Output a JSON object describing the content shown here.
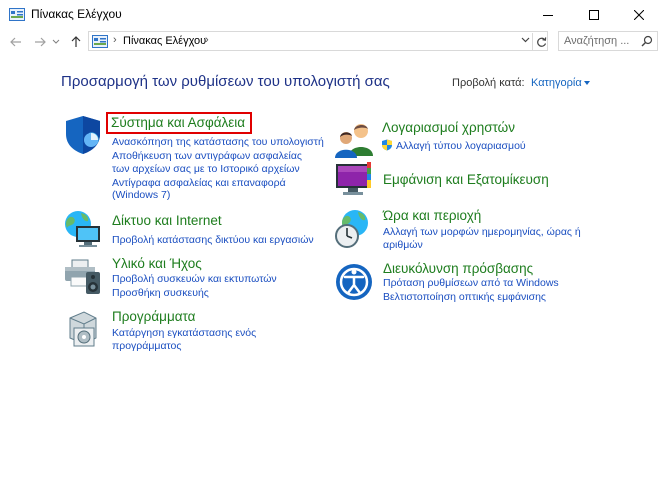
{
  "window": {
    "title": "Πίνακας Ελέγχου"
  },
  "address": {
    "path": "Πίνακας Ελέγχου",
    "search_placeholder": "Αναζήτηση ..."
  },
  "header": {
    "heading": "Προσαρμογή των ρυθμίσεων του υπολογιστή σας",
    "view_by_label": "Προβολή κατά:",
    "view_by_value": "Κατηγορία"
  },
  "categories_left": [
    {
      "title": "Σύστημα και Ασφάλεια",
      "links": [
        "Ανασκόπηση της κατάστασης του υπολογιστή",
        "Αποθήκευση των αντιγράφων ασφαλείας",
        "των αρχείων σας με το Ιστορικό αρχείων",
        "Αντίγραφα ασφαλείας και επαναφορά",
        "(Windows 7)"
      ]
    },
    {
      "title": "Δίκτυο και Internet",
      "links": [
        "Προβολή κατάστασης δικτύου και εργασιών"
      ]
    },
    {
      "title": "Υλικό και Ήχος",
      "links": [
        "Προβολή συσκευών και εκτυπωτών",
        "Προσθήκη συσκευής"
      ]
    },
    {
      "title": "Προγράμματα",
      "links": [
        "Κατάργηση εγκατάστασης ενός",
        "προγράμματος"
      ]
    }
  ],
  "categories_right": [
    {
      "title": "Λογαριασμοί χρηστών",
      "links": [
        "Αλλαγή τύπου λογαριασμού"
      ]
    },
    {
      "title": "Εμφάνιση και Εξατομίκευση",
      "links": []
    },
    {
      "title": "Ώρα και περιοχή",
      "links": [
        "Αλλαγή των μορφών ημερομηνίας, ώρας ή",
        "αριθμών"
      ]
    },
    {
      "title": "Διευκόλυνση πρόσβασης",
      "links": [
        "Πρόταση ρυθμίσεων από τα Windows",
        "Βελτιστοποίηση οπτικής εμφάνισης"
      ]
    }
  ],
  "colors": {
    "heading": "#1e3287",
    "category_title": "#1e7d1e",
    "link": "#1a4ec0",
    "highlight": "#e00000"
  }
}
